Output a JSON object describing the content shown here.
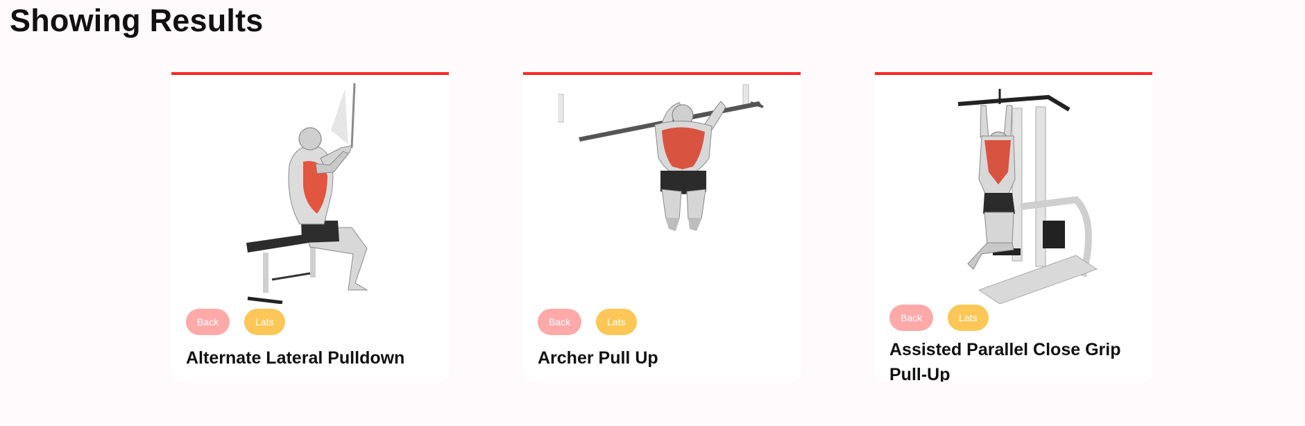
{
  "header": {
    "title": "Showing Results"
  },
  "colors": {
    "accent": "#ff2625",
    "body_part_tag": "#ffa9a9",
    "target_tag": "#fcc757",
    "background": "#fffafb"
  },
  "exercises": [
    {
      "name": "Alternate Lateral Pulldown",
      "body_part": "Back",
      "target": "Lats",
      "image_icon": "seated-lat-pulldown-illustration"
    },
    {
      "name": "Archer Pull Up",
      "body_part": "Back",
      "target": "Lats",
      "image_icon": "archer-pull-up-illustration"
    },
    {
      "name": "Assisted Parallel Close Grip Pull-Up",
      "body_part": "Back",
      "target": "Lats",
      "image_icon": "assisted-pull-up-machine-illustration"
    }
  ]
}
